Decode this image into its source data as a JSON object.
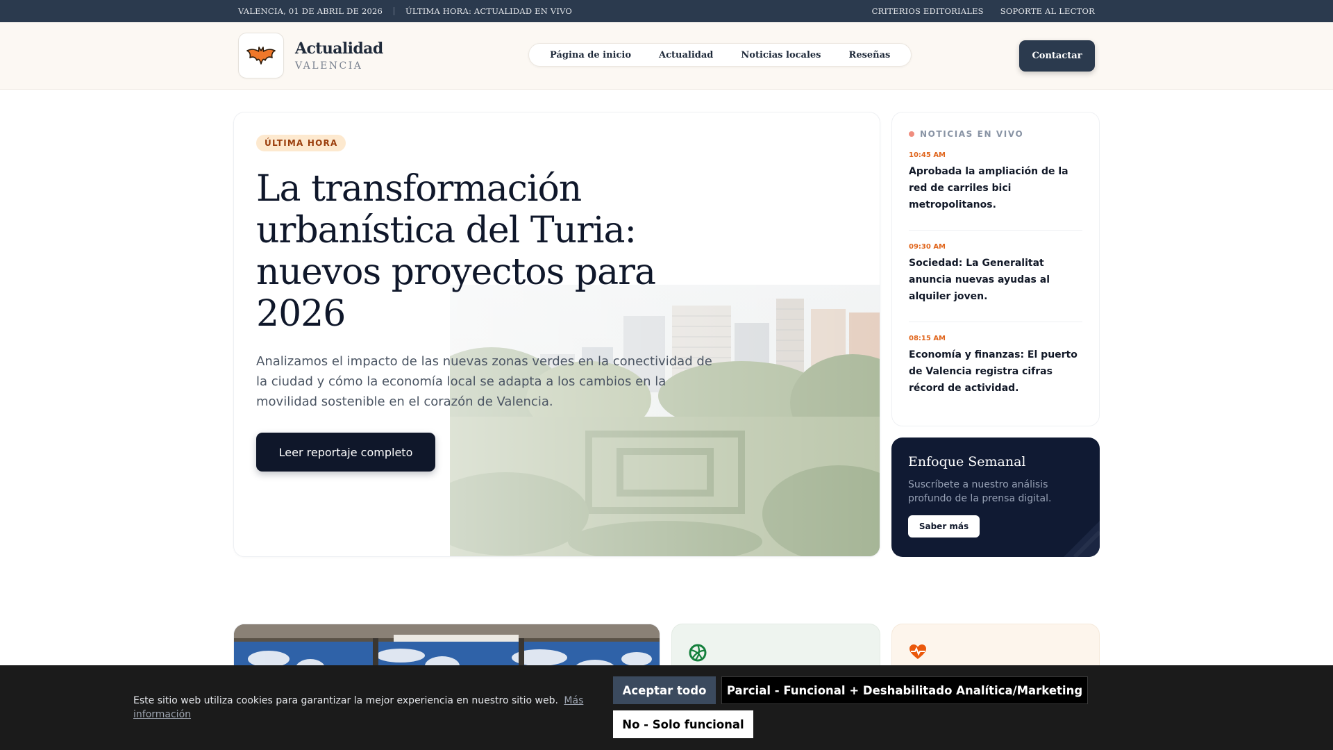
{
  "topbar": {
    "date": "VALENCIA, 01 DE ABRIL DE 2026",
    "breaking": "ÚLTIMA HORA: ACTUALIDAD EN VIVO",
    "links": [
      "CRITERIOS EDITORIALES",
      "SOPORTE AL LECTOR"
    ]
  },
  "header": {
    "brand_title": "Actualidad",
    "brand_subtitle": "VALENCIA",
    "logo_icon": "bat-icon",
    "nav": [
      "Página de inicio",
      "Actualidad",
      "Noticias locales",
      "Reseñas"
    ],
    "contact_label": "Contactar"
  },
  "hero": {
    "badge": "ÚLTIMA HORA",
    "headline": "La transformación urbanística del Turia: nuevos proyectos para 2026",
    "lead": "Analizamos el impacto de las nuevas zonas verdes en la conectividad de la ciudad y cómo la economía local se adapta a los cambios en la movilidad sostenible en el corazón de Valencia.",
    "cta_label": "Leer reportaje completo"
  },
  "live": {
    "title": "NOTICIAS EN VIVO",
    "items": [
      {
        "time": "10:45 AM",
        "text": "Aprobada la ampliación de la red de carriles bici metropolitanos."
      },
      {
        "time": "09:30 AM",
        "text": "Sociedad: La Generalitat anuncia nuevas ayudas al alquiler joven."
      },
      {
        "time": "08:15 AM",
        "text": "Economía y finanzas: El puerto de Valencia registra cifras récord de actividad."
      }
    ]
  },
  "weekly": {
    "title": "Enfoque Semanal",
    "text": "Suscríbete a nuestro análisis profundo de la prensa digital.",
    "button": "Saber más"
  },
  "cookie": {
    "text": "Este sitio web utiliza cookies para garantizar la mejor experiencia en nuestro sitio web.",
    "more_link": "Más información",
    "accept_all": "Aceptar todo",
    "partial": "Parcial - Funcional + Deshabilitado Analítica/Marketing",
    "no_functional": "No - Solo funcional"
  },
  "colors": {
    "dark_navy": "#2b3a4e",
    "accent_orange": "#e0651c",
    "deep_navy": "#0f172a"
  }
}
